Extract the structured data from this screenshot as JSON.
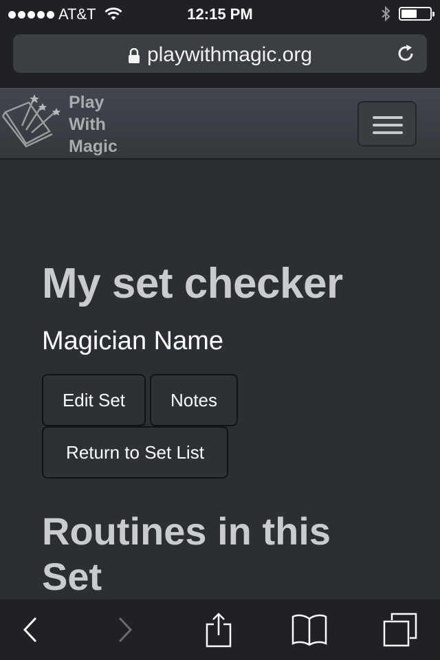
{
  "status_bar": {
    "carrier": "AT&T",
    "time": "12:15 PM"
  },
  "browser": {
    "url": "playwithmagic.org"
  },
  "site": {
    "brand_lines": [
      "Play",
      "With",
      "Magic"
    ],
    "menu_icon": "hamburger-menu-icon"
  },
  "page": {
    "title": "My set checker",
    "magician_name": "Magician Name",
    "buttons": {
      "edit_set": "Edit Set",
      "notes": "Notes",
      "return_to_set_list": "Return to Set List"
    },
    "routines_heading": "Routines in this Set"
  },
  "toolbar": {
    "icons": [
      "back-icon",
      "forward-icon",
      "share-icon",
      "bookmarks-icon",
      "tabs-icon"
    ]
  },
  "colors": {
    "background": "#2b2e33",
    "heading": "#c9cbce",
    "brand": "#a8abaf"
  }
}
